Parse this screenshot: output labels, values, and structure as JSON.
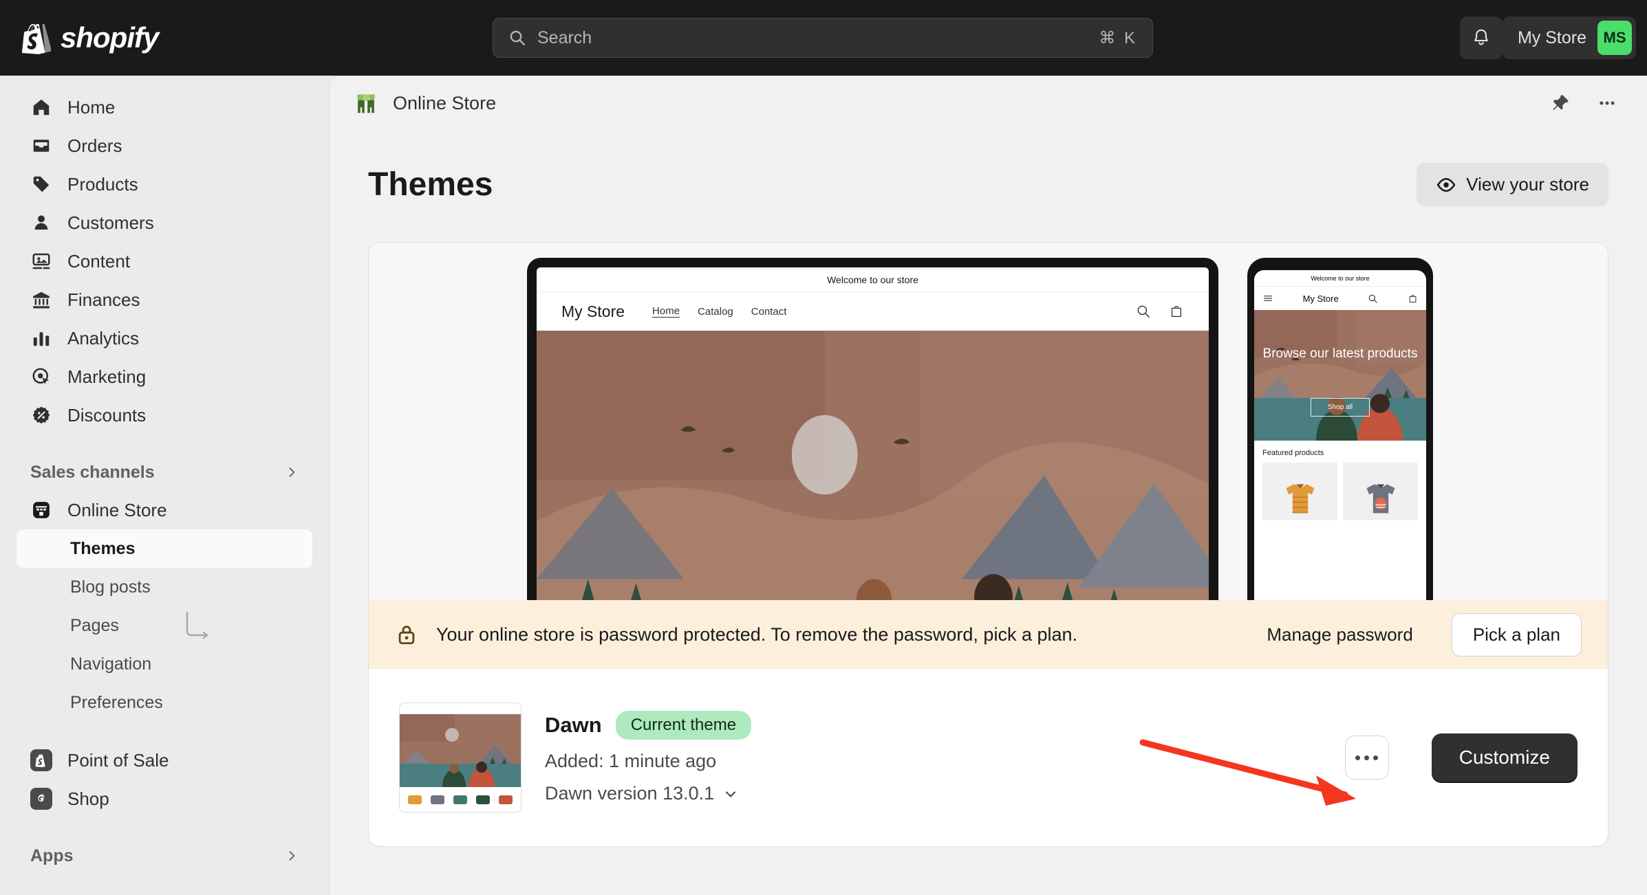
{
  "topbar": {
    "logo_text": "shopify",
    "logo_icon": "shopify-bag-icon",
    "search": {
      "placeholder": "Search",
      "shortcut": "⌘ K",
      "icon": "search-icon"
    },
    "notifications_icon": "bell-icon",
    "store_name": "My Store",
    "store_initials": "MS",
    "avatar_color": "#4ade6a"
  },
  "sidebar": {
    "items": [
      {
        "label": "Home",
        "icon": "home-icon"
      },
      {
        "label": "Orders",
        "icon": "orders-inbox-icon"
      },
      {
        "label": "Products",
        "icon": "tag-icon"
      },
      {
        "label": "Customers",
        "icon": "person-icon"
      },
      {
        "label": "Content",
        "icon": "image-icon"
      },
      {
        "label": "Finances",
        "icon": "bank-icon"
      },
      {
        "label": "Analytics",
        "icon": "bar-chart-icon"
      },
      {
        "label": "Marketing",
        "icon": "target-cursor-icon"
      },
      {
        "label": "Discounts",
        "icon": "discount-badge-icon"
      }
    ],
    "sales_channels_label": "Sales channels",
    "sales_channels_chevron": "chevron-right-icon",
    "online_store": {
      "label": "Online Store",
      "icon": "storefront-icon"
    },
    "sub_items": [
      {
        "label": "Themes",
        "active": true
      },
      {
        "label": "Blog posts",
        "active": false
      },
      {
        "label": "Pages",
        "active": false
      },
      {
        "label": "Navigation",
        "active": false
      },
      {
        "label": "Preferences",
        "active": false
      }
    ],
    "apps": [
      {
        "label": "Point of Sale",
        "icon": "shopify-pos-icon"
      },
      {
        "label": "Shop",
        "icon": "shop-app-icon"
      }
    ],
    "apps_label": "Apps",
    "apps_chevron": "chevron-right-icon"
  },
  "page_header": {
    "title": "Online Store",
    "icon": "online-store-green-icon",
    "pin_icon": "pin-icon",
    "more_icon": "ellipsis-icon"
  },
  "page": {
    "title": "Themes",
    "view_store_label": "View your store",
    "view_store_icon": "eye-icon"
  },
  "preview": {
    "desktop": {
      "announcement": "Welcome to our store",
      "logo": "My Store",
      "links": [
        "Home",
        "Catalog",
        "Contact"
      ],
      "active_link": "Home",
      "search_icon": "search-icon",
      "cart_icon": "cart-icon"
    },
    "mobile": {
      "announcement": "Welcome to our store",
      "menu_icon": "hamburger-icon",
      "logo": "My Store",
      "search_icon": "search-icon",
      "cart_icon": "cart-icon",
      "hero_heading": "Browse our latest products",
      "hero_button": "Shop all",
      "featured_title": "Featured products"
    }
  },
  "banner": {
    "icon": "lock-icon",
    "message": "Your online store is password protected. To remove the password, pick a plan.",
    "manage_label": "Manage password",
    "action_label": "Pick a plan",
    "background": "#fcefdc"
  },
  "theme": {
    "name": "Dawn",
    "badge": "Current theme",
    "badge_color": "#aee9c0",
    "added": "Added: 1 minute ago",
    "version": "Dawn version 13.0.1",
    "version_chevron": "chevron-down-icon",
    "more_icon": "ellipsis-icon",
    "customize_label": "Customize"
  },
  "annotation": {
    "arrow_color": "#f5361e",
    "points_to": "Customize"
  }
}
